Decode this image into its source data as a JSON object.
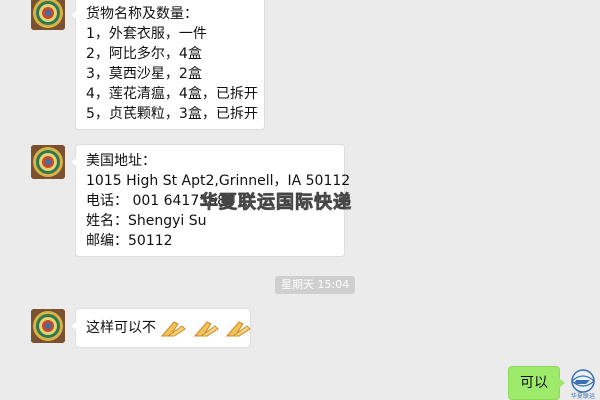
{
  "messages": {
    "goods": {
      "lines": [
        "货物名称及数量：",
        "1，外套衣服，一件",
        "2，阿比多尔，4盒",
        "3，莫西沙星，2盒",
        "4，莲花清瘟，4盒，已拆开",
        "5，贞芪颗粒，3盒，已拆开"
      ]
    },
    "address": {
      "lines": [
        "美国地址：",
        "1015 High St Apt2,Grinnell，IA 50112",
        "电话： 001 6417568",
        "姓名：Shengyi Su",
        "邮编：50112"
      ]
    },
    "timestamp": "星期天 15:04",
    "question": {
      "text": "这样可以不"
    },
    "reply": {
      "text": "可以"
    }
  },
  "watermark": "华夏联运国际快递",
  "logo_text": "华夏联运",
  "colors": {
    "background": "#ebebeb",
    "bubble_left": "#ffffff",
    "bubble_right": "#9eea6a",
    "timestamp_bg": "#cfcfcf"
  },
  "icons": [
    "avatar-mandala",
    "clasped-hands-emoji",
    "company-logo"
  ]
}
